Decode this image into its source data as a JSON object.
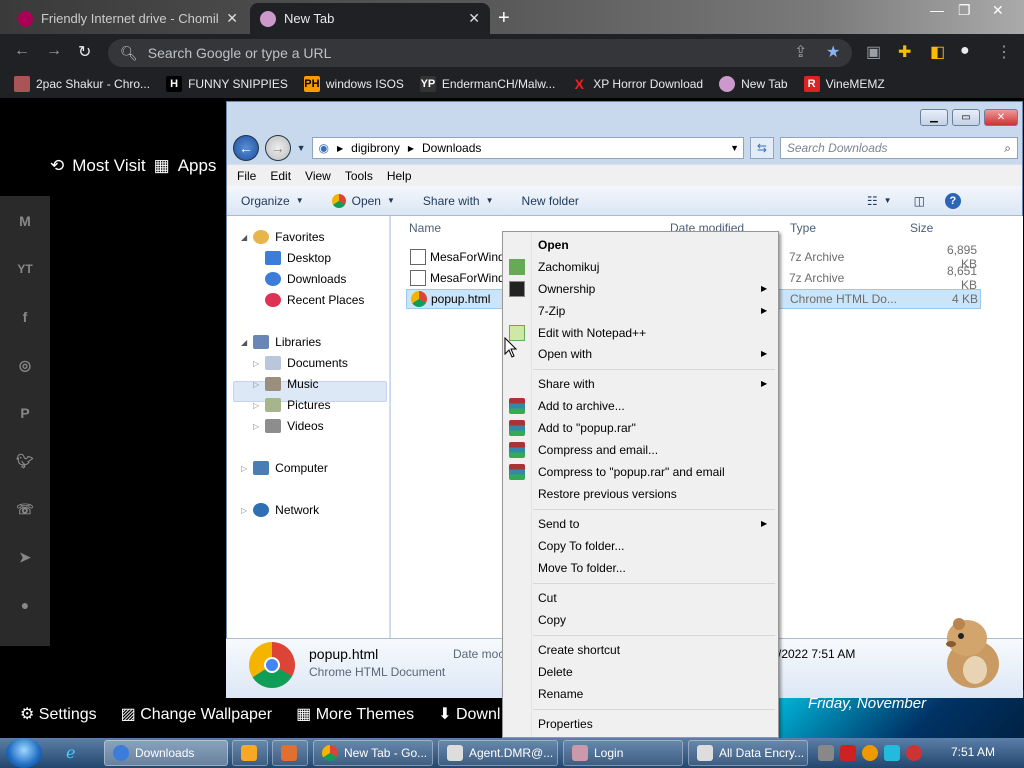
{
  "browser": {
    "tabs": [
      {
        "label": "Friendly Internet drive - Chomiku",
        "active": false
      },
      {
        "label": "New Tab",
        "active": true
      }
    ],
    "new_tab_glyph": "+",
    "omnibox_placeholder": "Search Google or type a URL",
    "bookmarks": [
      {
        "label": "2pac Shakur - Chro...",
        "icon": "2pac-icon"
      },
      {
        "label": "FUNNY SNIPPIES",
        "icon": "h-icon"
      },
      {
        "label": "windows ISOS",
        "icon": "ph-icon"
      },
      {
        "label": "EndermanCH/Malw...",
        "icon": "yp-icon"
      },
      {
        "label": "XP Horror Download",
        "icon": "x-icon"
      },
      {
        "label": "New Tab",
        "icon": "newtab-icon"
      },
      {
        "label": "VineMEMZ",
        "icon": "r-icon"
      }
    ]
  },
  "newtab": {
    "most_visited": "Most Visit",
    "apps": "Apps",
    "settings": "Settings",
    "change_wallpaper": "Change Wallpaper",
    "more_themes": "More Themes",
    "download": "Downl",
    "date": "Friday, November"
  },
  "explorer": {
    "breadcrumb": [
      "digibrony",
      "Downloads"
    ],
    "search_placeholder": "Search Downloads",
    "menu": [
      "File",
      "Edit",
      "View",
      "Tools",
      "Help"
    ],
    "commands": {
      "organize": "Organize",
      "open": "Open",
      "share": "Share with",
      "newfolder": "New folder"
    },
    "nav": {
      "favorites": "Favorites",
      "desktop": "Desktop",
      "downloads": "Downloads",
      "recent": "Recent Places",
      "libraries": "Libraries",
      "documents": "Documents",
      "music": "Music",
      "pictures": "Pictures",
      "videos": "Videos",
      "computer": "Computer",
      "network": "Network"
    },
    "columns": {
      "name": "Name",
      "date": "Date modified",
      "type": "Type",
      "size": "Size"
    },
    "files": [
      {
        "name": "MesaForWind",
        "type": "7z Archive",
        "size": "6,895 KB"
      },
      {
        "name": "MesaForWind",
        "type": "7z Archive",
        "size": "8,651 KB"
      },
      {
        "name": "popup.html",
        "type": "Chrome HTML Do...",
        "size": "4 KB"
      }
    ],
    "details": {
      "name": "popup.html",
      "kind": "Chrome HTML Document",
      "date_label": "Date moc",
      "date_value": "/2022 7:51 AM"
    }
  },
  "context_menu": {
    "open": "Open",
    "zachomikuj": "Zachomikuj",
    "ownership": "Ownership",
    "sevenzip": "7-Zip",
    "notepad": "Edit with Notepad++",
    "openwith": "Open with",
    "sharewith": "Share with",
    "addarchive": "Add to archive...",
    "addrar": "Add to \"popup.rar\"",
    "compress_email": "Compress and email...",
    "compress_rar_email": "Compress to \"popup.rar\" and email",
    "restore": "Restore previous versions",
    "sendto": "Send to",
    "copyto": "Copy To folder...",
    "moveto": "Move To folder...",
    "cut": "Cut",
    "copy": "Copy",
    "shortcut": "Create shortcut",
    "delete": "Delete",
    "rename": "Rename",
    "properties": "Properties"
  },
  "taskbar": {
    "items": [
      "Downloads",
      "New Tab - Go...",
      "Agent.DMR@...",
      "Login",
      "All Data Encry..."
    ],
    "clock": "7:51 AM"
  }
}
